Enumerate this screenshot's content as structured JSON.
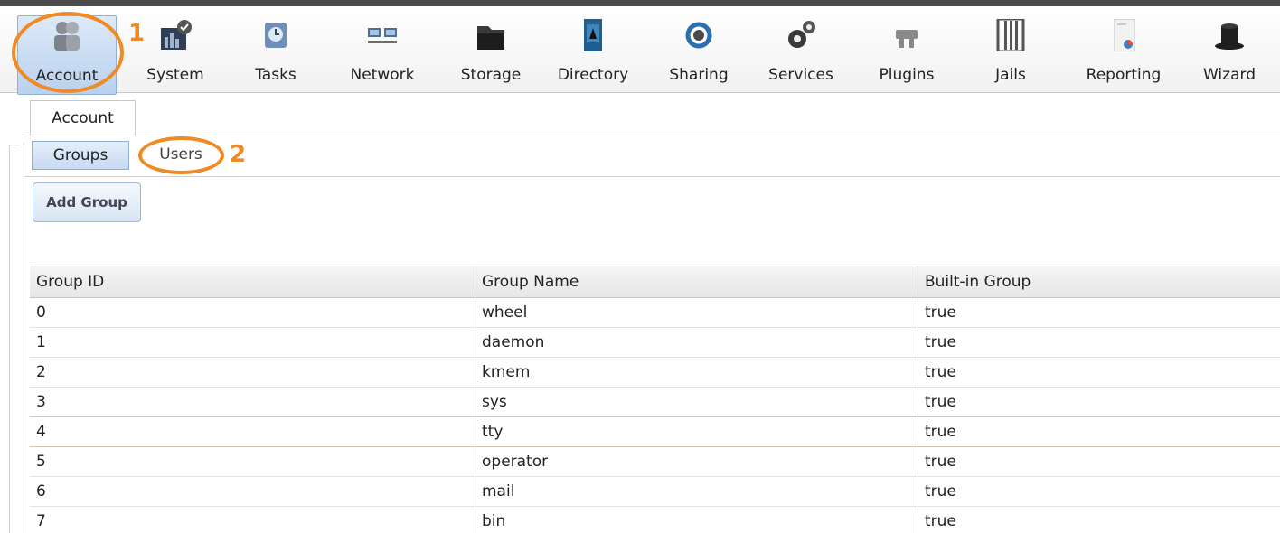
{
  "toolbar": {
    "items": [
      {
        "label": "Account",
        "icon": "account-icon",
        "active": true
      },
      {
        "label": "System",
        "icon": "system-icon"
      },
      {
        "label": "Tasks",
        "icon": "tasks-icon"
      },
      {
        "label": "Network",
        "icon": "network-icon"
      },
      {
        "label": "Storage",
        "icon": "storage-icon"
      },
      {
        "label": "Directory",
        "icon": "directory-icon"
      },
      {
        "label": "Sharing",
        "icon": "sharing-icon"
      },
      {
        "label": "Services",
        "icon": "services-icon"
      },
      {
        "label": "Plugins",
        "icon": "plugins-icon"
      },
      {
        "label": "Jails",
        "icon": "jails-icon"
      },
      {
        "label": "Reporting",
        "icon": "reporting-icon"
      },
      {
        "label": "Wizard",
        "icon": "wizard-icon"
      }
    ]
  },
  "annotations": {
    "first": "1",
    "second": "2",
    "color": "#f08a24"
  },
  "main_tab": {
    "label": "Account"
  },
  "sub_tabs": {
    "groups": "Groups",
    "users": "Users"
  },
  "actions": {
    "add_group": "Add Group"
  },
  "table": {
    "columns": [
      "Group ID",
      "Group Name",
      "Built-in Group"
    ],
    "rows": [
      [
        "0",
        "wheel",
        "true"
      ],
      [
        "1",
        "daemon",
        "true"
      ],
      [
        "2",
        "kmem",
        "true"
      ],
      [
        "3",
        "sys",
        "true"
      ],
      [
        "4",
        "tty",
        "true"
      ],
      [
        "5",
        "operator",
        "true"
      ],
      [
        "6",
        "mail",
        "true"
      ],
      [
        "7",
        "bin",
        "true"
      ]
    ]
  }
}
